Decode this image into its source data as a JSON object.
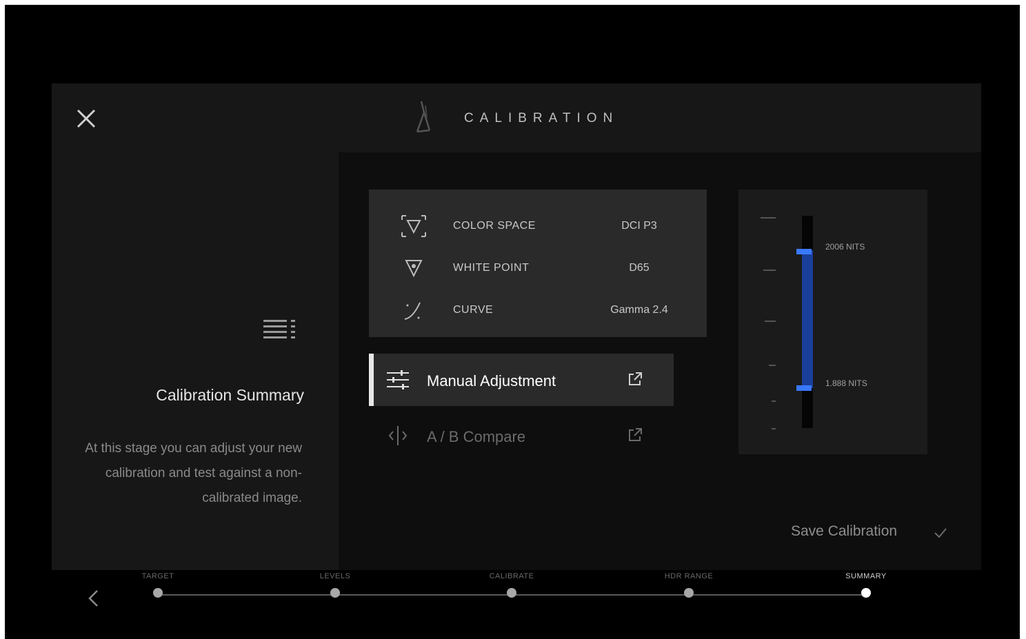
{
  "header": {
    "title": "CALIBRATION"
  },
  "sidebar": {
    "heading": "Calibration Summary",
    "description": "At this stage you can adjust your new calibration and test against a non-calibrated image."
  },
  "settings": [
    {
      "label": "COLOR SPACE",
      "value": "DCI P3",
      "icon": "color-space-icon"
    },
    {
      "label": "WHITE POINT",
      "value": "D65",
      "icon": "white-point-icon"
    },
    {
      "label": "CURVE",
      "value": "Gamma 2.4",
      "icon": "curve-icon"
    }
  ],
  "actions": [
    {
      "label": "Manual Adjustment",
      "icon": "sliders-icon",
      "active": true
    },
    {
      "label": "A / B Compare",
      "icon": "compare-icon",
      "active": false
    }
  ],
  "nits": {
    "max_label": "2006 NITS",
    "min_label": "1.888 NITS"
  },
  "footer": {
    "save_label": "Save Calibration"
  },
  "steps": [
    {
      "label": "TARGET"
    },
    {
      "label": "LEVELS"
    },
    {
      "label": "CALIBRATE"
    },
    {
      "label": "HDR RANGE"
    },
    {
      "label": "SUMMARY"
    }
  ],
  "current_step": 4,
  "colors": {
    "accent": "#3a78ff",
    "range_fill": "#1a3f9a",
    "background": "#171717"
  }
}
